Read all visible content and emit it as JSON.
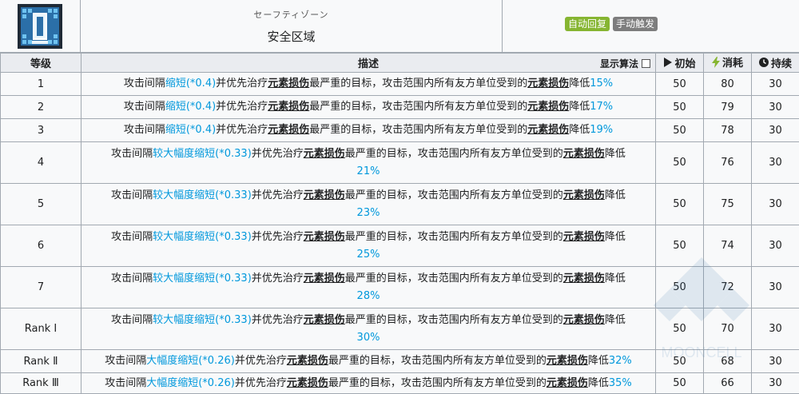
{
  "skill": {
    "name_jp": "セーフティゾーン",
    "name_cn": "安全区域",
    "tags": [
      {
        "label": "自动回复",
        "color": "#86b531"
      },
      {
        "label": "手动触发",
        "color": "#7d7d7d"
      }
    ]
  },
  "table": {
    "headers": {
      "level": "等级",
      "desc": "描述",
      "toggle": "显示算法",
      "initial": "初始",
      "cost": "消耗",
      "duration": "持续"
    },
    "desc_parts": {
      "pre": "攻击间隔",
      "mid1": "并优先治疗",
      "ul": "元素损伤",
      "mid2": "最严重的目标，攻击范围内所有友方单位受到的",
      "post": "降低"
    },
    "rows": [
      {
        "level": "1",
        "speed": "缩短(*0.4)",
        "value": "15%",
        "initial": "50",
        "cost": "80",
        "duration": "30"
      },
      {
        "level": "2",
        "speed": "缩短(*0.4)",
        "value": "17%",
        "initial": "50",
        "cost": "79",
        "duration": "30"
      },
      {
        "level": "3",
        "speed": "缩短(*0.4)",
        "value": "19%",
        "initial": "50",
        "cost": "78",
        "duration": "30"
      },
      {
        "level": "4",
        "speed": "较大幅度缩短(*0.33)",
        "value": "21%",
        "initial": "50",
        "cost": "76",
        "duration": "30"
      },
      {
        "level": "5",
        "speed": "较大幅度缩短(*0.33)",
        "value": "23%",
        "initial": "50",
        "cost": "75",
        "duration": "30"
      },
      {
        "level": "6",
        "speed": "较大幅度缩短(*0.33)",
        "value": "25%",
        "initial": "50",
        "cost": "74",
        "duration": "30"
      },
      {
        "level": "7",
        "speed": "较大幅度缩短(*0.33)",
        "value": "28%",
        "initial": "50",
        "cost": "72",
        "duration": "30"
      },
      {
        "level": "Rank Ⅰ",
        "speed": "较大幅度缩短(*0.33)",
        "value": "30%",
        "initial": "50",
        "cost": "70",
        "duration": "30"
      },
      {
        "level": "Rank Ⅱ",
        "speed": "大幅度缩短(*0.26)",
        "value": "32%",
        "initial": "50",
        "cost": "68",
        "duration": "30"
      },
      {
        "level": "Rank Ⅲ",
        "speed": "大幅度缩短(*0.26)",
        "value": "35%",
        "initial": "50",
        "cost": "66",
        "duration": "30"
      }
    ]
  },
  "watermark": "MOONCELL"
}
